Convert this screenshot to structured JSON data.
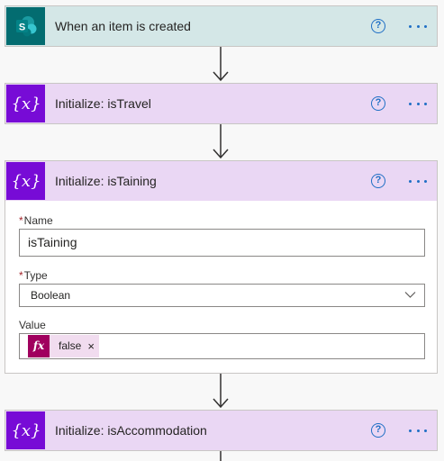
{
  "flow": {
    "steps": [
      {
        "title": "When an item is created",
        "kind": "sharepoint"
      },
      {
        "title": "Initialize: isTravel",
        "kind": "variable"
      },
      {
        "title": "Initialize: isTaining",
        "kind": "variable"
      },
      {
        "title": "Initialize: isAccommodation",
        "kind": "variable"
      }
    ],
    "help_glyph": "?",
    "variable_tile_glyph": "{x}",
    "expanded_step": {
      "name_label": "Name",
      "name_value": "isTaining",
      "type_label": "Type",
      "type_value": "Boolean",
      "value_label": "Value",
      "value_token": {
        "icon": "fx",
        "text": "false",
        "remove_glyph": "×"
      },
      "required_marker": "*"
    }
  },
  "colors": {
    "sharepoint_header": "#d4e7e7",
    "sharepoint_tile": "#036c70",
    "variable_header": "#ead7f4",
    "variable_tile": "#770bd6",
    "accent_blue": "#1f6fc5",
    "expression_token": "#a0005e"
  },
  "icons": {
    "sharepoint": "sharepoint-icon",
    "variable": "variable-icon",
    "help": "help-icon",
    "more": "more-icon",
    "arrow": "arrow-down-icon",
    "chevron": "chevron-down-icon",
    "expression": "expression-icon",
    "remove": "remove-token-icon"
  }
}
